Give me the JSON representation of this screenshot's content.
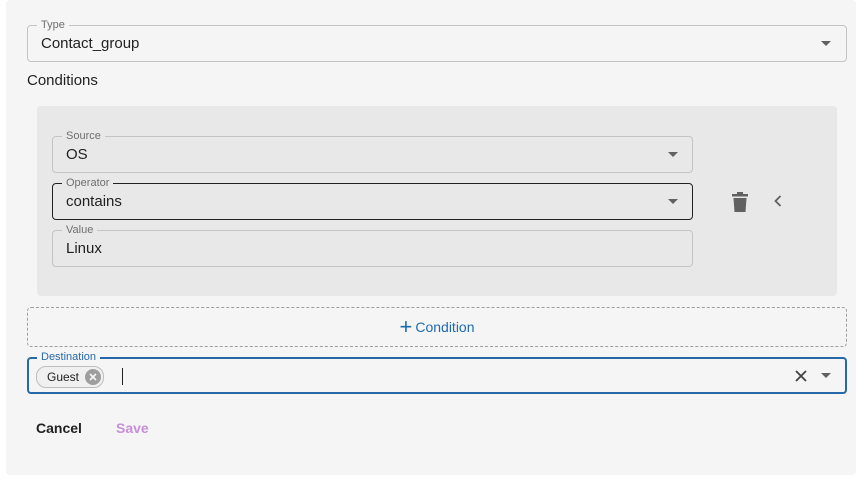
{
  "type_field": {
    "label": "Type",
    "value": "Contact_group"
  },
  "conditions": {
    "title": "Conditions",
    "source": {
      "label": "Source",
      "value": "OS"
    },
    "operator": {
      "label": "Operator",
      "value": "contains"
    },
    "value": {
      "label": "Value",
      "value": "Linux"
    }
  },
  "add_condition": {
    "label": "Condition"
  },
  "destination": {
    "label": "Destination",
    "chips": [
      "Guest"
    ]
  },
  "actions": {
    "cancel_label": "Cancel",
    "save_label": "Save"
  },
  "colors": {
    "accent": "#2769a8",
    "save_disabled": "#c78fd6",
    "link": "#1e6bb0"
  },
  "icons": {
    "delete": "trash-icon",
    "collapse": "chevron-left-icon",
    "clear": "close-icon",
    "dropdown": "caret-down-icon"
  }
}
